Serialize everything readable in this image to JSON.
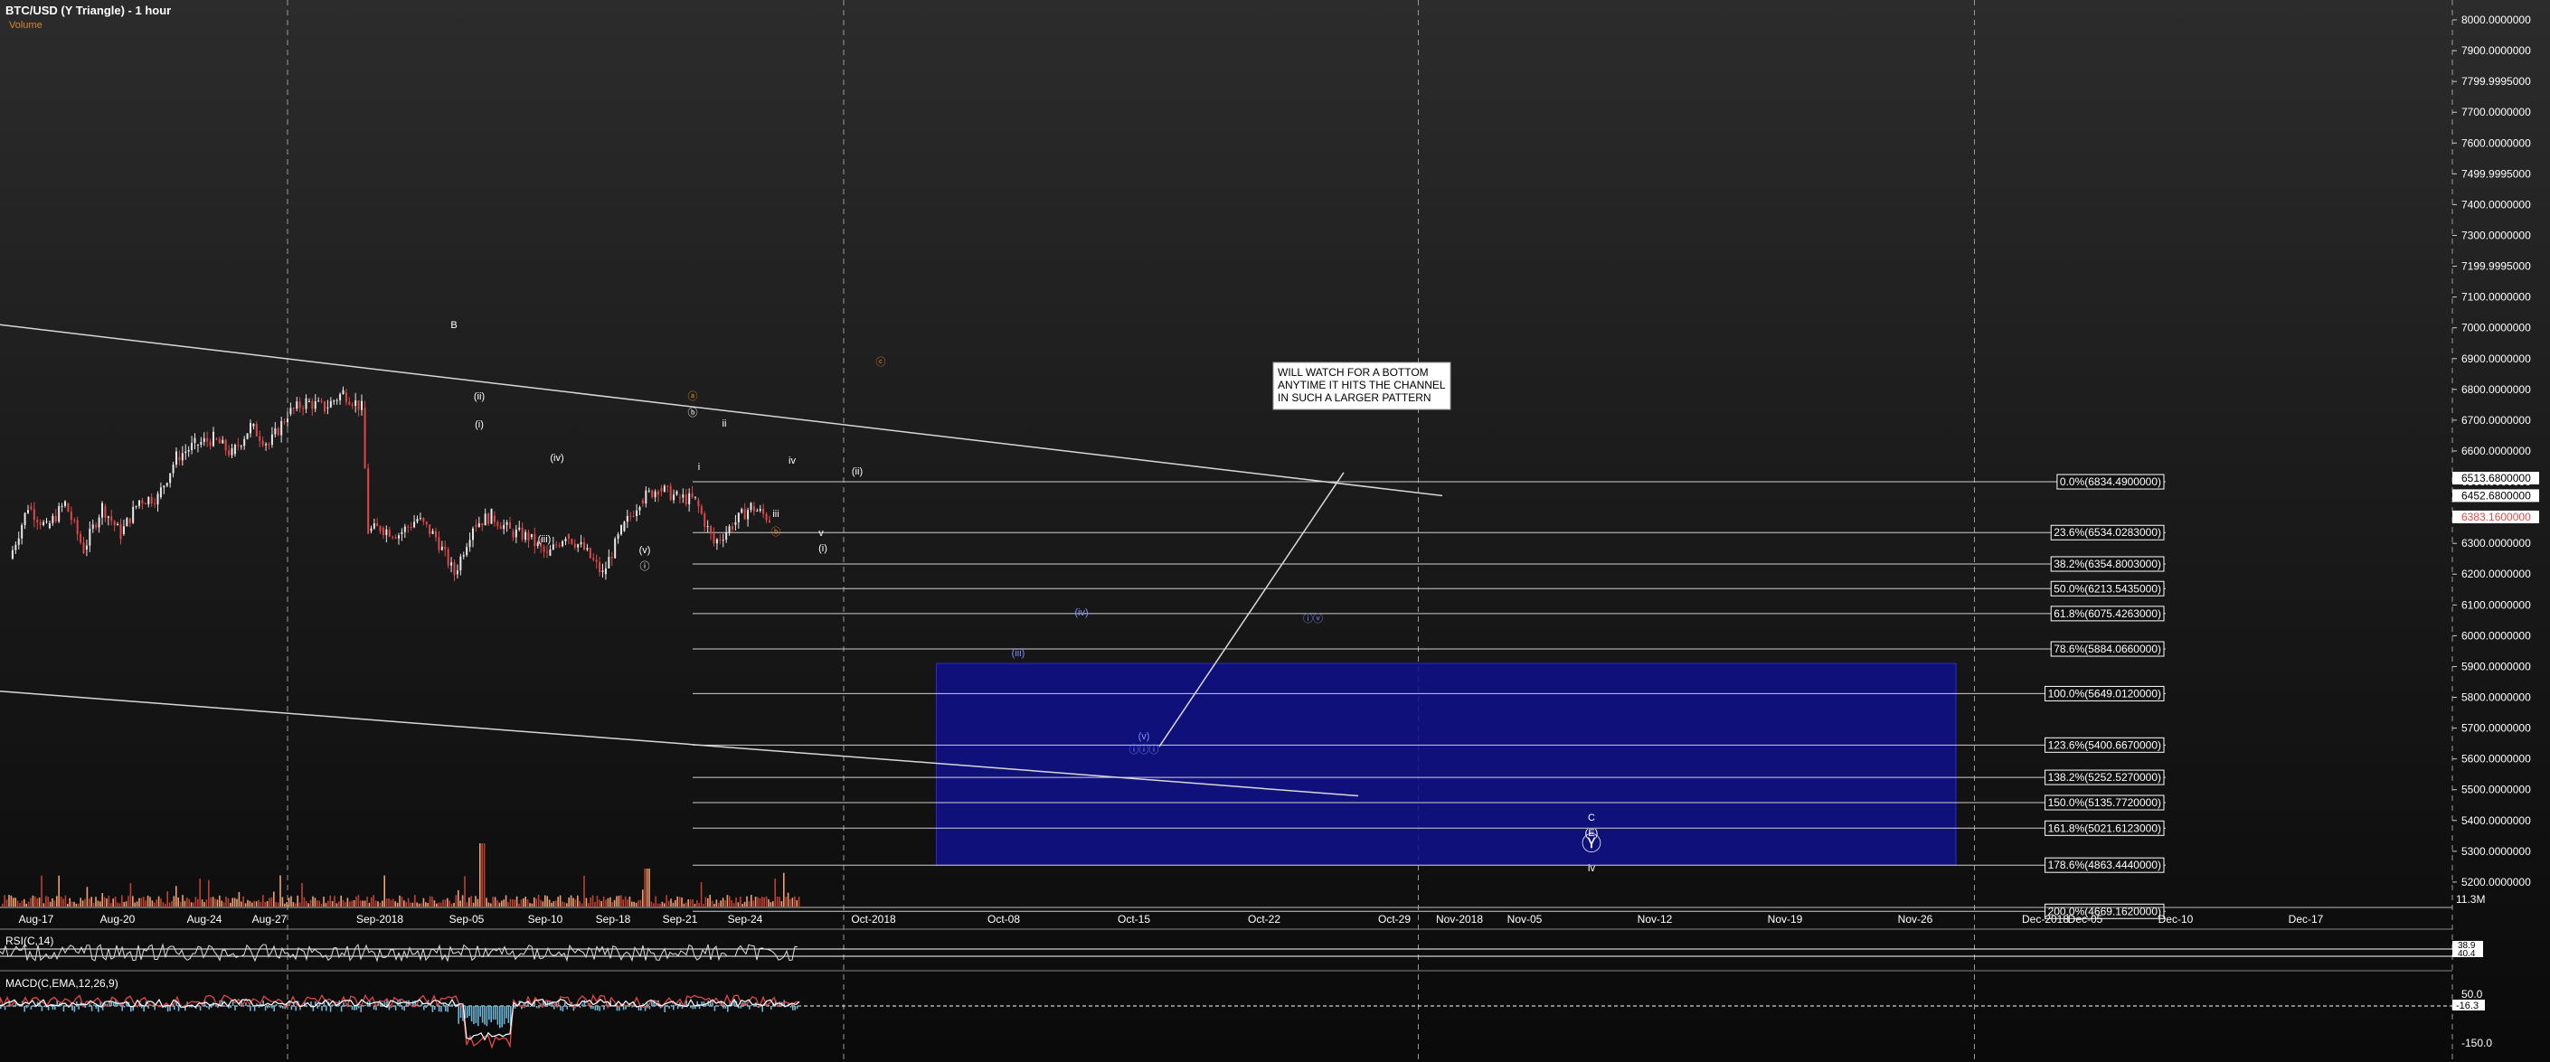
{
  "header": {
    "title": "BTC/USD (Y Triangle) - 1 hour",
    "volume_label": "Volume"
  },
  "colors": {
    "up": "#e8e8e8",
    "down": "#e04848",
    "volume_up": "#f0a070",
    "volume_down": "#c04030",
    "line": "#d8d8d8",
    "box": "#10108a",
    "orange": "#e0802a",
    "fib_box": "#ffffff"
  },
  "chart_data": [
    {
      "type": "candlestick",
      "title": "BTC/USD (Y Triangle) - 1 hour",
      "x_ticks": [
        "Aug-17",
        "Aug-20",
        "Aug-24",
        "Aug-27",
        "Sep-2018",
        "Sep-05",
        "Sep-10",
        "Sep-18",
        "Sep-21",
        "Sep-24",
        "Oct-2018",
        "Oct-08",
        "Oct-15",
        "Oct-22",
        "Oct-29",
        "Nov-2018",
        "Nov-05",
        "Nov-12",
        "Nov-19",
        "Nov-26",
        "Dec-2018",
        "Dec-05",
        "Dec-10",
        "Dec-17"
      ],
      "y_ticks": [
        "8000.0000000",
        "7900.0000000",
        "7799.9995000",
        "7700.0000000",
        "7600.0000000",
        "7499.9995000",
        "7400.0000000",
        "7300.0000000",
        "7199.9995000",
        "7100.0000000",
        "7000.0000000",
        "6900.0000000",
        "6800.0000000",
        "6700.0000000",
        "6600.0000000",
        "6500.0000000",
        "6300.0000000",
        "6200.0000000",
        "6100.0000000",
        "6000.0000000",
        "5900.0000000",
        "5800.0000000",
        "5700.0000000",
        "5600.0000000",
        "5500.0000000",
        "5400.0000000",
        "5300.0000000",
        "5200.0000000"
      ],
      "ylim": [
        5100,
        8000
      ],
      "grid_dates": [
        "Sep-2018",
        "Oct-2018",
        "Nov-2018",
        "Dec-2018"
      ],
      "price_path": [
        {
          "x": "Aug-17",
          "y": 6250
        },
        {
          "x": "Aug-18",
          "y": 6420
        },
        {
          "x": "Aug-19",
          "y": 6350
        },
        {
          "x": "Aug-20",
          "y": 6430
        },
        {
          "x": "Aug-21",
          "y": 6280
        },
        {
          "x": "Aug-22",
          "y": 6420
        },
        {
          "x": "Aug-23",
          "y": 6330
        },
        {
          "x": "Aug-24",
          "y": 6440
        },
        {
          "x": "Aug-25",
          "y": 6450
        },
        {
          "x": "Aug-26",
          "y": 6580
        },
        {
          "x": "Aug-27",
          "y": 6620
        },
        {
          "x": "Aug-28",
          "y": 6640
        },
        {
          "x": "Aug-29",
          "y": 6590
        },
        {
          "x": "Aug-30",
          "y": 6680
        },
        {
          "x": "Aug-31",
          "y": 6620
        },
        {
          "x": "Sep-01",
          "y": 6720
        },
        {
          "x": "Sep-02",
          "y": 6760
        },
        {
          "x": "Sep-03",
          "y": 6740
        },
        {
          "x": "Sep-04",
          "y": 6790
        },
        {
          "x": "Sep-05",
          "y": 6740
        },
        {
          "x": "Sep-05b",
          "y": 6340
        },
        {
          "x": "Sep-06",
          "y": 6350
        },
        {
          "x": "Sep-07",
          "y": 6330
        },
        {
          "x": "Sep-08",
          "y": 6380
        },
        {
          "x": "Sep-09",
          "y": 6320
        },
        {
          "x": "Sep-10",
          "y": 6200
        },
        {
          "x": "Sep-11",
          "y": 6360
        },
        {
          "x": "Sep-12",
          "y": 6390
        },
        {
          "x": "Sep-13",
          "y": 6340
        },
        {
          "x": "Sep-14",
          "y": 6320
        },
        {
          "x": "Sep-15",
          "y": 6260
        },
        {
          "x": "Sep-16",
          "y": 6330
        },
        {
          "x": "Sep-17",
          "y": 6280
        },
        {
          "x": "Sep-18",
          "y": 6200
        },
        {
          "x": "Sep-19",
          "y": 6340
        },
        {
          "x": "Sep-20",
          "y": 6440
        },
        {
          "x": "Sep-21",
          "y": 6480
        },
        {
          "x": "Sep-22",
          "y": 6450
        },
        {
          "x": "Sep-23",
          "y": 6440
        },
        {
          "x": "Sep-24",
          "y": 6300
        },
        {
          "x": "Sep-25",
          "y": 6360
        },
        {
          "x": "Sep-26",
          "y": 6420
        },
        {
          "x": "Sep-27",
          "y": 6380
        }
      ],
      "fib_levels": [
        {
          "label": "0.0%(6834.4900000)",
          "value": 6500
        },
        {
          "label": "23.6%(6534.0283000)",
          "value": 6335
        },
        {
          "label": "38.2%(6354.8003000)",
          "value": 6233
        },
        {
          "label": "50.0%(6213.5435000)",
          "value": 6153
        },
        {
          "label": "61.8%(6075.4263000)",
          "value": 6072
        },
        {
          "label": "78.6%(5884.0660000)",
          "value": 5957
        },
        {
          "label": "100.0%(5649.0120000)",
          "value": 5812
        },
        {
          "label": "123.6%(5400.6670000)",
          "value": 5645
        },
        {
          "label": "138.2%(5252.5270000)",
          "value": 5540
        },
        {
          "label": "150.0%(5135.7720000)",
          "value": 5458
        },
        {
          "label": "161.8%(5021.6123000)",
          "value": 5375
        },
        {
          "label": "178.6%(4863.4440000)",
          "value": 5255
        },
        {
          "label": "200.0%(4669.1620000)",
          "value": 5105
        }
      ],
      "price_flags": [
        {
          "label": "6452.6800000",
          "value": 6452
        },
        {
          "label": "6383.1600000",
          "value": 6383
        }
      ],
      "annotation": "WILL WATCH FOR A BOTTOM ANYTIME IT HITS THE CHANNEL IN SUCH A LARGER PATTERN",
      "annotation_lines": [
        "WILL WATCH FOR A BOTTOM",
        "ANYTIME IT HITS THE CHANNEL",
        "IN SUCH A LARGER PATTERN"
      ],
      "wave_labels": [
        {
          "text": "B",
          "color": "white"
        },
        {
          "text": "(i)",
          "color": "white"
        },
        {
          "text": "(ii)",
          "color": "white"
        },
        {
          "text": "(iii)",
          "color": "white"
        },
        {
          "text": "(iv)",
          "color": "white"
        },
        {
          "text": "(v)",
          "color": "white"
        },
        {
          "text": "ⓘ",
          "color": "white"
        },
        {
          "text": "ⓐ",
          "color": "orange"
        },
        {
          "text": "ⓑ",
          "color": "white"
        },
        {
          "text": "i",
          "color": "white"
        },
        {
          "text": "ii",
          "color": "white"
        },
        {
          "text": "iii",
          "color": "white"
        },
        {
          "text": "iv",
          "color": "white"
        },
        {
          "text": "v",
          "color": "white"
        },
        {
          "text": "ⓑ",
          "color": "orange"
        },
        {
          "text": "(ii)",
          "color": "white"
        },
        {
          "text": "(i)",
          "color": "white"
        },
        {
          "text": "ⓒ",
          "color": "orange"
        },
        {
          "text": "(iii)",
          "color": "blue"
        },
        {
          "text": "(iv)",
          "color": "blue"
        },
        {
          "text": "(v)",
          "color": "blue"
        },
        {
          "text": "ⓘⓘⓘ",
          "color": "blue"
        },
        {
          "text": "ⓘⓥ",
          "color": "blue"
        },
        {
          "text": "C",
          "color": "white"
        },
        {
          "text": "(E)",
          "color": "white"
        },
        {
          "text": "Ⓨ",
          "color": "white"
        },
        {
          "text": "iv",
          "color": "white"
        }
      ],
      "target_box": {
        "from": "Oct-06",
        "to": "Nov-30",
        "top": 5910,
        "bottom": 5255
      },
      "volume_flag": "11.3M"
    },
    {
      "type": "line",
      "title": "RSI(C,14)",
      "flags": [
        "38.9",
        "40.4"
      ]
    },
    {
      "type": "line",
      "title": "MACD(C,EMA,12,26,9)",
      "y_ticks": [
        "50.0",
        "-150.0"
      ],
      "flags": [
        "-16.3"
      ]
    }
  ]
}
